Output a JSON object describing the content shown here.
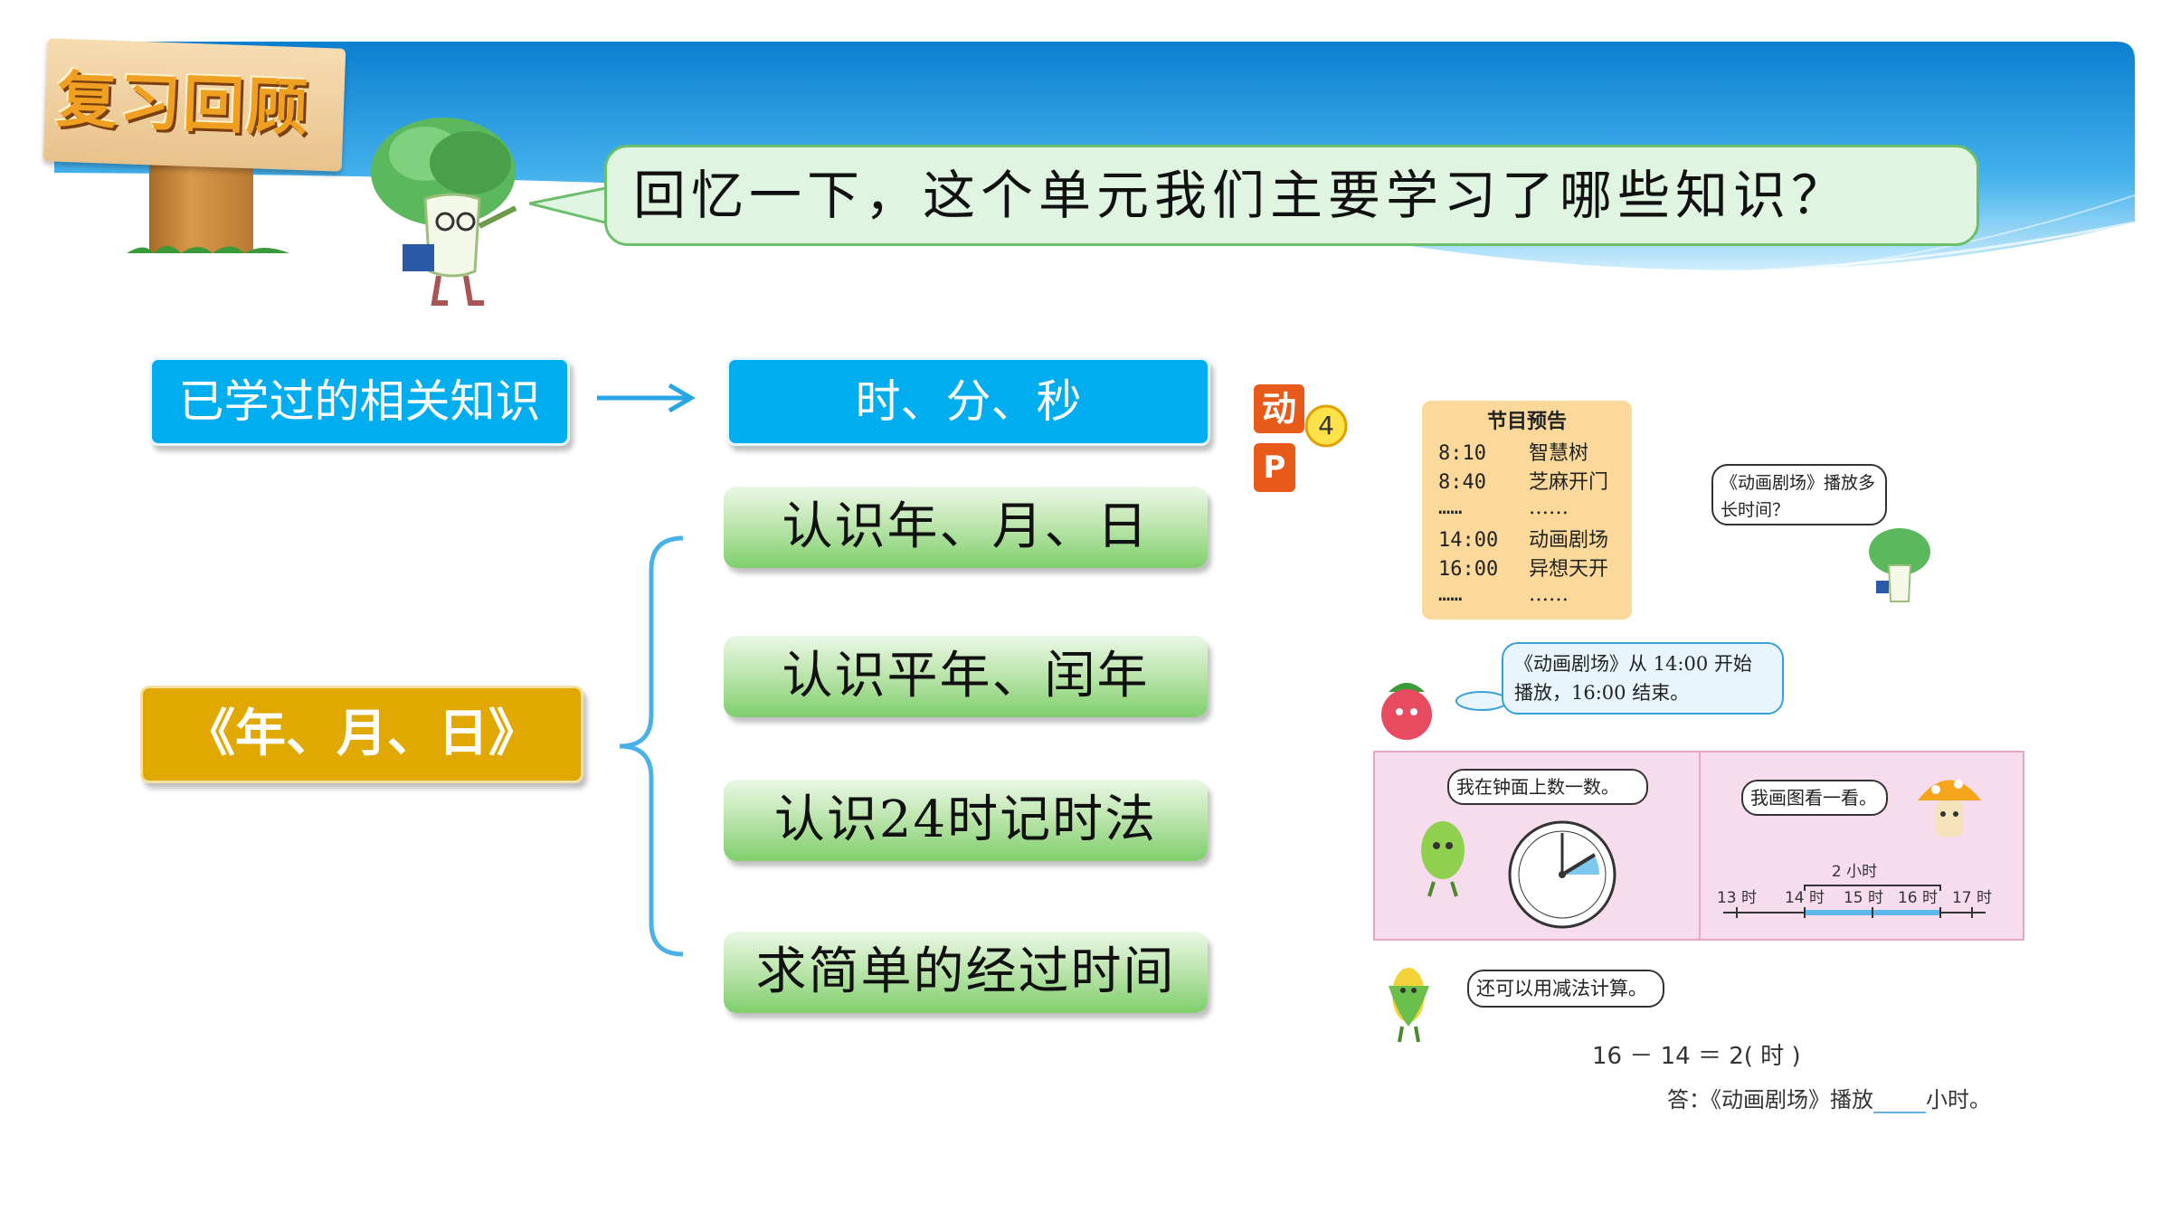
{
  "header": {
    "sign_label": "复习回顾",
    "question": "回忆一下，这个单元我们主要学习了哪些知识？"
  },
  "mindmap": {
    "known_label": "已学过的相关知识",
    "known_topic": "时、分、秒",
    "unit_label": "《年、月、日》",
    "topics": [
      "认识年、月、日",
      "认识平年、闰年",
      "认识24时记时法",
      "求简单的经过时间"
    ]
  },
  "icons": {
    "dong": "动",
    "number": "4",
    "ppt": "P"
  },
  "textbook": {
    "schedule_title": "节目预告",
    "schedule": [
      {
        "time": "8:10",
        "program": "智慧树"
      },
      {
        "time": "8:40",
        "program": "芝麻开门"
      },
      {
        "time": "……",
        "program": "……"
      },
      {
        "time": "14:00",
        "program": "动画剧场"
      },
      {
        "time": "16:00",
        "program": "异想天开"
      },
      {
        "time": "……",
        "program": "……"
      }
    ],
    "question_bubble": "《动画剧场》播放多长时间？",
    "info_bubble_line1": "《动画剧场》从 14:00 开始",
    "info_bubble_line2": "播放，16:00 结束。",
    "clock_bubble": "我在钟面上数一数。",
    "timeline_bubble": "我画图看一看。",
    "timeline_span": "2 小时",
    "timeline_ticks": [
      "13 时",
      "14 时",
      "15 时",
      "16 时",
      "17 时"
    ],
    "subtract_bubble": "还可以用减法计算。",
    "equation": "16 － 14 ＝ 2( 时 )",
    "answer_prefix": "答：《动画剧场》播放",
    "answer_suffix": "小时。"
  },
  "colors": {
    "header_blue": "#1a8fd6",
    "box_blue": "#00aeef",
    "box_yellow": "#e0a800",
    "box_green": "#7fcf6c",
    "brace_blue": "#4ab0e8"
  }
}
